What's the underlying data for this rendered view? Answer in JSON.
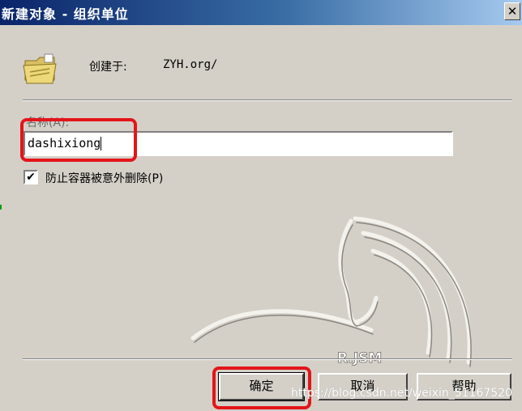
{
  "window": {
    "title": "新建对象 - 组织单位",
    "close_glyph": "✕"
  },
  "created_in": {
    "label": "创建于:",
    "value": "ZYH.org/"
  },
  "name_field": {
    "label": "名称(A):",
    "value": "dashixiong"
  },
  "protect_checkbox": {
    "checked": true,
    "check_glyph": "✔",
    "label": "防止容器被意外删除(P)"
  },
  "logo": {
    "text": "R.JSM"
  },
  "buttons": {
    "ok": "确定",
    "cancel": "取消",
    "help": "帮助"
  },
  "watermark": "https://blog.csdn.net/weixin_51167520",
  "colors": {
    "window_bg": "#d4d0c8",
    "title_start": "#0a246a",
    "title_end": "#a6caf0",
    "highlight": "#e3151a"
  }
}
